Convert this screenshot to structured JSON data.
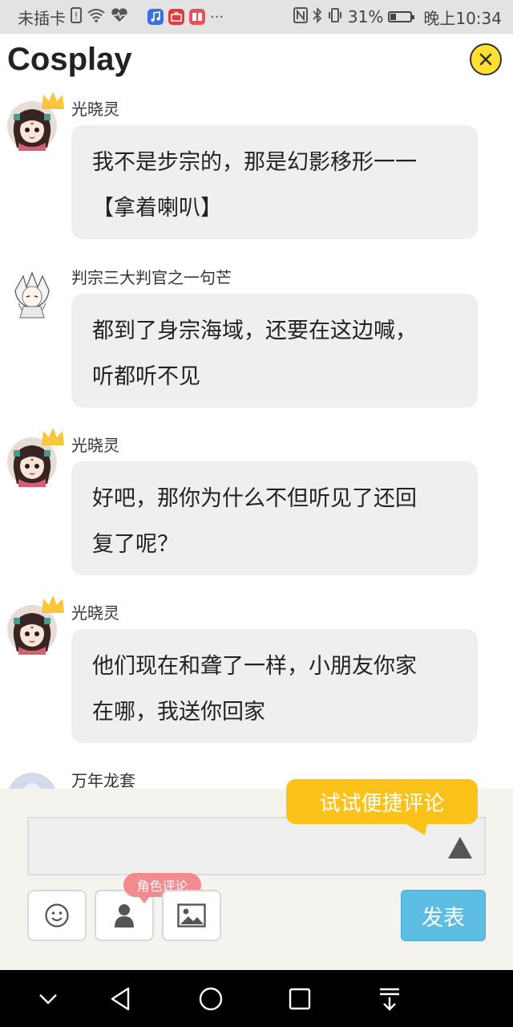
{
  "status_bar": {
    "carrier": "未插卡",
    "battery": "31%",
    "battery_level": 0.31,
    "time": "晚上10:34",
    "icons": [
      "sim-missing-icon",
      "wifi-icon",
      "heart-rate-icon",
      "music-app-icon",
      "shop-app-icon",
      "reader-app-icon",
      "more-icon",
      "nfc-icon",
      "bluetooth-icon",
      "vibrate-icon",
      "battery-icon"
    ]
  },
  "header": {
    "title": "Cosplay",
    "close_icon": "close-icon",
    "accent_color": "#ffe033"
  },
  "messages": [
    {
      "user": "光晓灵",
      "avatar": "avatar-guangxiaoling",
      "crown": true,
      "lines": [
        "我不是步宗的，那是幻影移形一一",
        "【拿着喇叭】"
      ]
    },
    {
      "user": "判宗三大判官之一句芒",
      "avatar": "avatar-jumang",
      "crown": false,
      "lines": [
        "都到了身宗海域，还要在这边喊，",
        "听都听不见"
      ]
    },
    {
      "user": "光晓灵",
      "avatar": "avatar-guangxiaoling",
      "crown": true,
      "lines": [
        "好吧，那你为什么不但听见了还回",
        "复了呢？"
      ]
    },
    {
      "user": "光晓灵",
      "avatar": "avatar-guangxiaoling",
      "crown": true,
      "lines": [
        "他们现在和聋了一样，小朋友你家",
        "在哪，我送你回家"
      ]
    },
    {
      "user": "万年龙套",
      "avatar": "avatar-default",
      "crown": false,
      "lines": []
    }
  ],
  "composer": {
    "tooltip": "试试便捷评论",
    "input_value": "",
    "role_tag": "角色评论",
    "publish_label": "发表",
    "tool_icons": [
      "emoji-icon",
      "person-icon",
      "image-icon"
    ],
    "tooltip_color": "#fbc21a",
    "publish_color": "#5dbde2"
  },
  "nav_bar": {
    "icons": [
      "chevron-down-icon",
      "back-icon",
      "home-icon",
      "recents-icon",
      "notification-pull-icon"
    ]
  }
}
